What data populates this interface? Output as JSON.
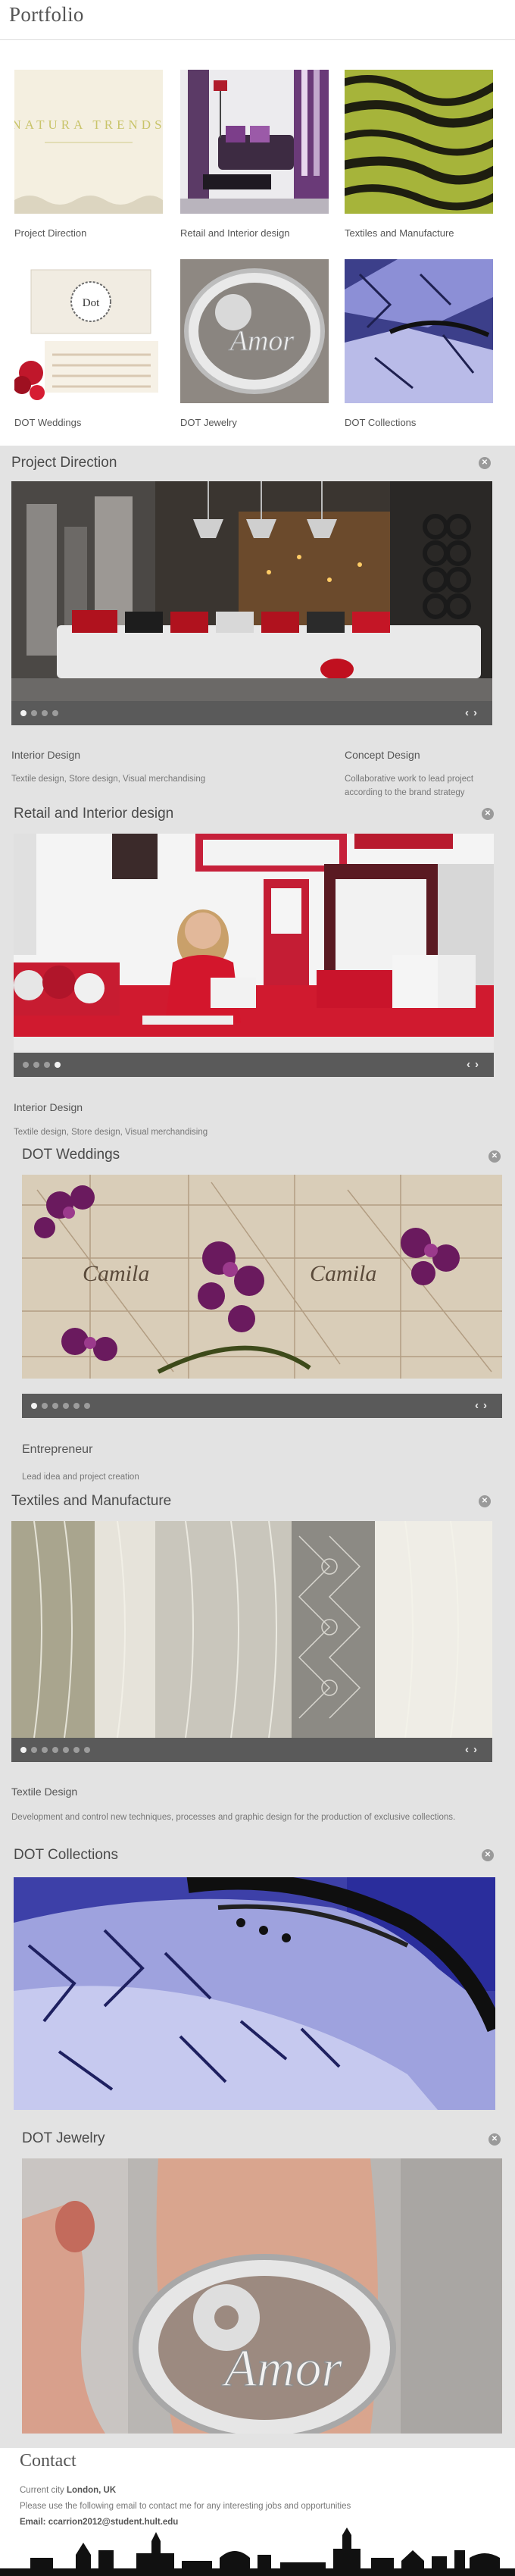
{
  "header": {
    "title": "Portfolio"
  },
  "grid": [
    {
      "label": "Project Direction",
      "thumb_text": "NATURA TRENDS"
    },
    {
      "label": "Retail and Interior design"
    },
    {
      "label": "Textiles and Manufacture"
    },
    {
      "label": "DOT Weddings",
      "thumb_text": "Dot"
    },
    {
      "label": "DOT Jewelry",
      "thumb_text": "Amor"
    },
    {
      "label": "DOT Collections"
    }
  ],
  "sections": {
    "project_direction": {
      "title": "Project Direction",
      "slides": 4,
      "active": 1,
      "left_head": "Interior Design",
      "left_text": "Textile design, Store design, Visual merchandising",
      "right_head": "Concept Design",
      "right_text": "Collaborative work to lead project according to the brand strategy"
    },
    "retail": {
      "title": "Retail and Interior design",
      "slides": 4,
      "active": 4,
      "head": "Interior Design",
      "text": "Textile design, Store design, Visual merchandising"
    },
    "weddings": {
      "title": "DOT Weddings",
      "slides": 6,
      "active": 1,
      "banner_names": [
        "Camila",
        "Camila"
      ],
      "head": "Entrepreneur",
      "text": "Lead idea and project creation"
    },
    "textiles": {
      "title": "Textiles and Manufacture",
      "slides": 7,
      "active": 1,
      "head": "Textile Design",
      "text": "Development and control new techniques, processes and graphic design for the production of exclusive collections."
    },
    "collections": {
      "title": "DOT Collections"
    },
    "jewelry": {
      "title": "DOT Jewelry",
      "ring_text": "Amor"
    }
  },
  "contact": {
    "title": "Contact",
    "city_label": "Current city",
    "city": "London, UK",
    "note": "Please use the following email to contact me for any interesting  jobs and opportunities",
    "email_label": "Email:",
    "email": "ccarrion2012@student.hult.edu"
  },
  "icons": {
    "close": "close-icon",
    "prev": "chevron-left-icon",
    "next": "chevron-right-icon"
  },
  "colors": {
    "page_bg": "#e3e3e3",
    "control_bar": "#5a5a5a",
    "accent_red": "#c8102e"
  }
}
